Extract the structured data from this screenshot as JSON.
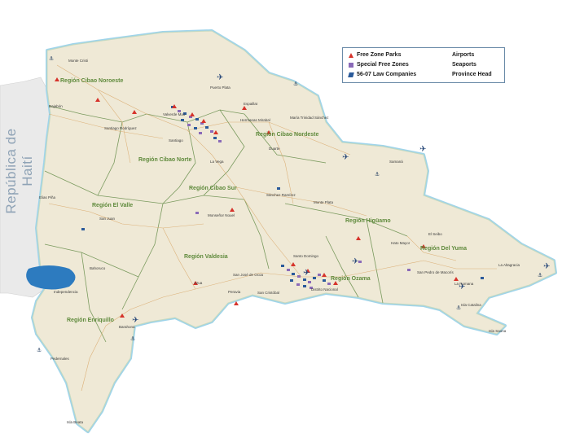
{
  "legend": {
    "items": [
      {
        "label": "Free Zone Parks",
        "icon": "free-zone-park-icon"
      },
      {
        "label": "Special Free Zones",
        "icon": "special-free-zone-icon"
      },
      {
        "label": "56-07 Law Companies",
        "icon": "law-company-icon"
      },
      {
        "label": "Airports",
        "icon": "airport-icon"
      },
      {
        "label": "Seaports",
        "icon": "seaport-icon"
      },
      {
        "label": "Province Head",
        "icon": "province-head-icon"
      }
    ]
  },
  "neighbor_label": "República de Haití",
  "regions": [
    "Región Cibao Noroeste",
    "Región Cibao Nordeste",
    "Región Cibao Norte",
    "Región Cibao Sur",
    "Región El Valle",
    "Región Higüamo",
    "Región Valdesia",
    "Región Del Yuma",
    "Región Ozama",
    "Región Enriquillo"
  ],
  "places": [
    "Monte Cristi",
    "Dajabón",
    "Santiago Rodríguez",
    "Valverde Mao",
    "Santiago",
    "Puerto Plata",
    "Espaillat",
    "Hermanas Mirabal",
    "María Trinidad Sánchez",
    "Duarte",
    "Samaná",
    "La Vega",
    "Sánchez Ramírez",
    "Monte Plata",
    "Elias Piña",
    "San Juan",
    "Monseñor Nouel",
    "Hato Mayor",
    "El Seibo",
    "La Altagracia",
    "Bahoruco",
    "Independencia",
    "Azua",
    "San José de Ocoa",
    "San Cristóbal",
    "Santo Domingo",
    "Distrito Nacional",
    "San Pedro de Macorís",
    "La Romana",
    "Isla Catalina",
    "Isla Saona",
    "Barahona",
    "Pedernales",
    "Isla Beata",
    "Peravia"
  ],
  "colors": {
    "sea": "#ffffff",
    "coast_glow": "#b9e2f2",
    "land": "#efe9d6",
    "haiti": "#eaeaea",
    "region_border": "#7a9a5e",
    "region_text": "#5f8a3c",
    "road": "#d9a86a",
    "lake": "#2d7bbf",
    "free_zone": "#d6332b",
    "special_free_zone": "#8a6ab8",
    "law_company": "#2a5a9a"
  }
}
